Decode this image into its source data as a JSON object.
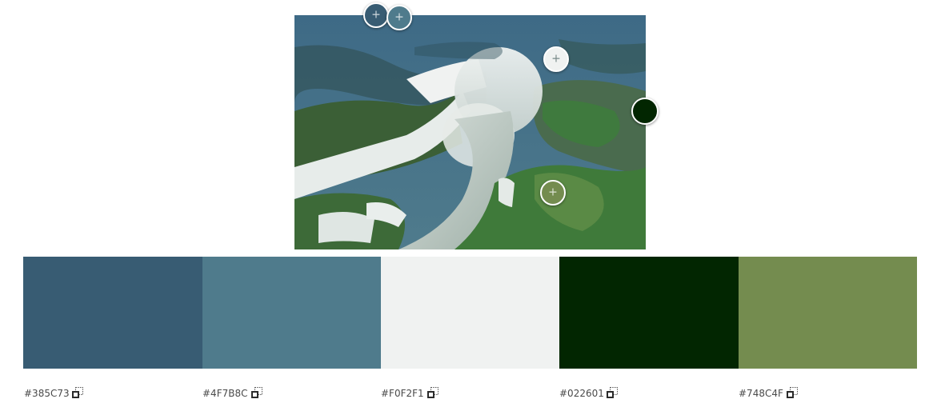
{
  "image": {
    "alt": "aerial-waterfall-photo"
  },
  "markers": [
    {
      "name": "color-marker-1",
      "color": "#385C73",
      "plus": "+"
    },
    {
      "name": "color-marker-2",
      "color": "#4F7B8C",
      "plus": "+"
    },
    {
      "name": "color-marker-3",
      "color": "#F0F2F1",
      "plus": "+"
    },
    {
      "name": "color-marker-4",
      "color": "#022601",
      "plus": ""
    },
    {
      "name": "color-marker-5",
      "color": "#748C4F",
      "plus": "+"
    }
  ],
  "palette": [
    {
      "hex": "#385C73",
      "copy_icon": "copy-icon"
    },
    {
      "hex": "#4F7B8C",
      "copy_icon": "copy-icon"
    },
    {
      "hex": "#F0F2F1",
      "copy_icon": "copy-icon"
    },
    {
      "hex": "#022601",
      "copy_icon": "copy-icon"
    },
    {
      "hex": "#748C4F",
      "copy_icon": "copy-icon"
    }
  ]
}
